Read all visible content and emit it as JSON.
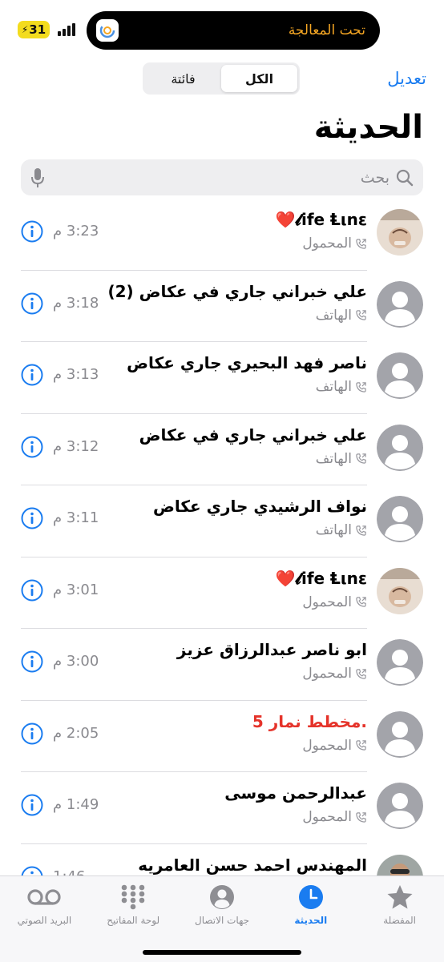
{
  "status": {
    "battery": "31",
    "island_text": "تحت المعالجة"
  },
  "header": {
    "edit_label": "تعديل",
    "segments": [
      "الكل",
      "فائتة"
    ],
    "title": "الحديثة"
  },
  "search": {
    "placeholder": "بحث"
  },
  "calls": [
    {
      "name": "𝓵ife Ⱡιnε❤️",
      "type": "المحمول",
      "time": "3:23 م",
      "missed": false
    },
    {
      "name": "علي خبراني جاري في عكاض  (2)",
      "type": "الهاتف",
      "time": "3:18 م",
      "missed": false
    },
    {
      "name": "ناصر فهد البحيري جاري عكاض",
      "type": "الهاتف",
      "time": "3:13 م",
      "missed": false
    },
    {
      "name": "علي خبراني جاري في عكاض",
      "type": "الهاتف",
      "time": "3:12 م",
      "missed": false
    },
    {
      "name": "نواف الرشيدي جاري عكاض",
      "type": "الهاتف",
      "time": "3:11 م",
      "missed": false
    },
    {
      "name": "𝓵ife Ⱡιnε❤️",
      "type": "المحمول",
      "time": "3:01 م",
      "missed": false
    },
    {
      "name": "ابو ناصر عبدالرزاق عزيز",
      "type": "المحمول",
      "time": "3:00 م",
      "missed": false
    },
    {
      "name": ".مخطط نمار 5",
      "type": "المحمول",
      "time": "2:05 م",
      "missed": true
    },
    {
      "name": "عبدالرحمن موسى",
      "type": "المحمول",
      "time": "1:49 م",
      "missed": false
    },
    {
      "name": "المهندس احمد حسن العامريه",
      "type": "",
      "time": "1:46",
      "missed": false
    }
  ],
  "tabs": [
    {
      "label": "المفضلة"
    },
    {
      "label": "الحديثة"
    },
    {
      "label": "جهات الاتصال"
    },
    {
      "label": "لوحة المفاتيح"
    },
    {
      "label": "البريد الصوتي"
    }
  ],
  "colors": {
    "accent": "#1a7cf0",
    "missed": "#e5332a",
    "secondary": "#8a8a8f",
    "island_text": "#f5a623"
  }
}
